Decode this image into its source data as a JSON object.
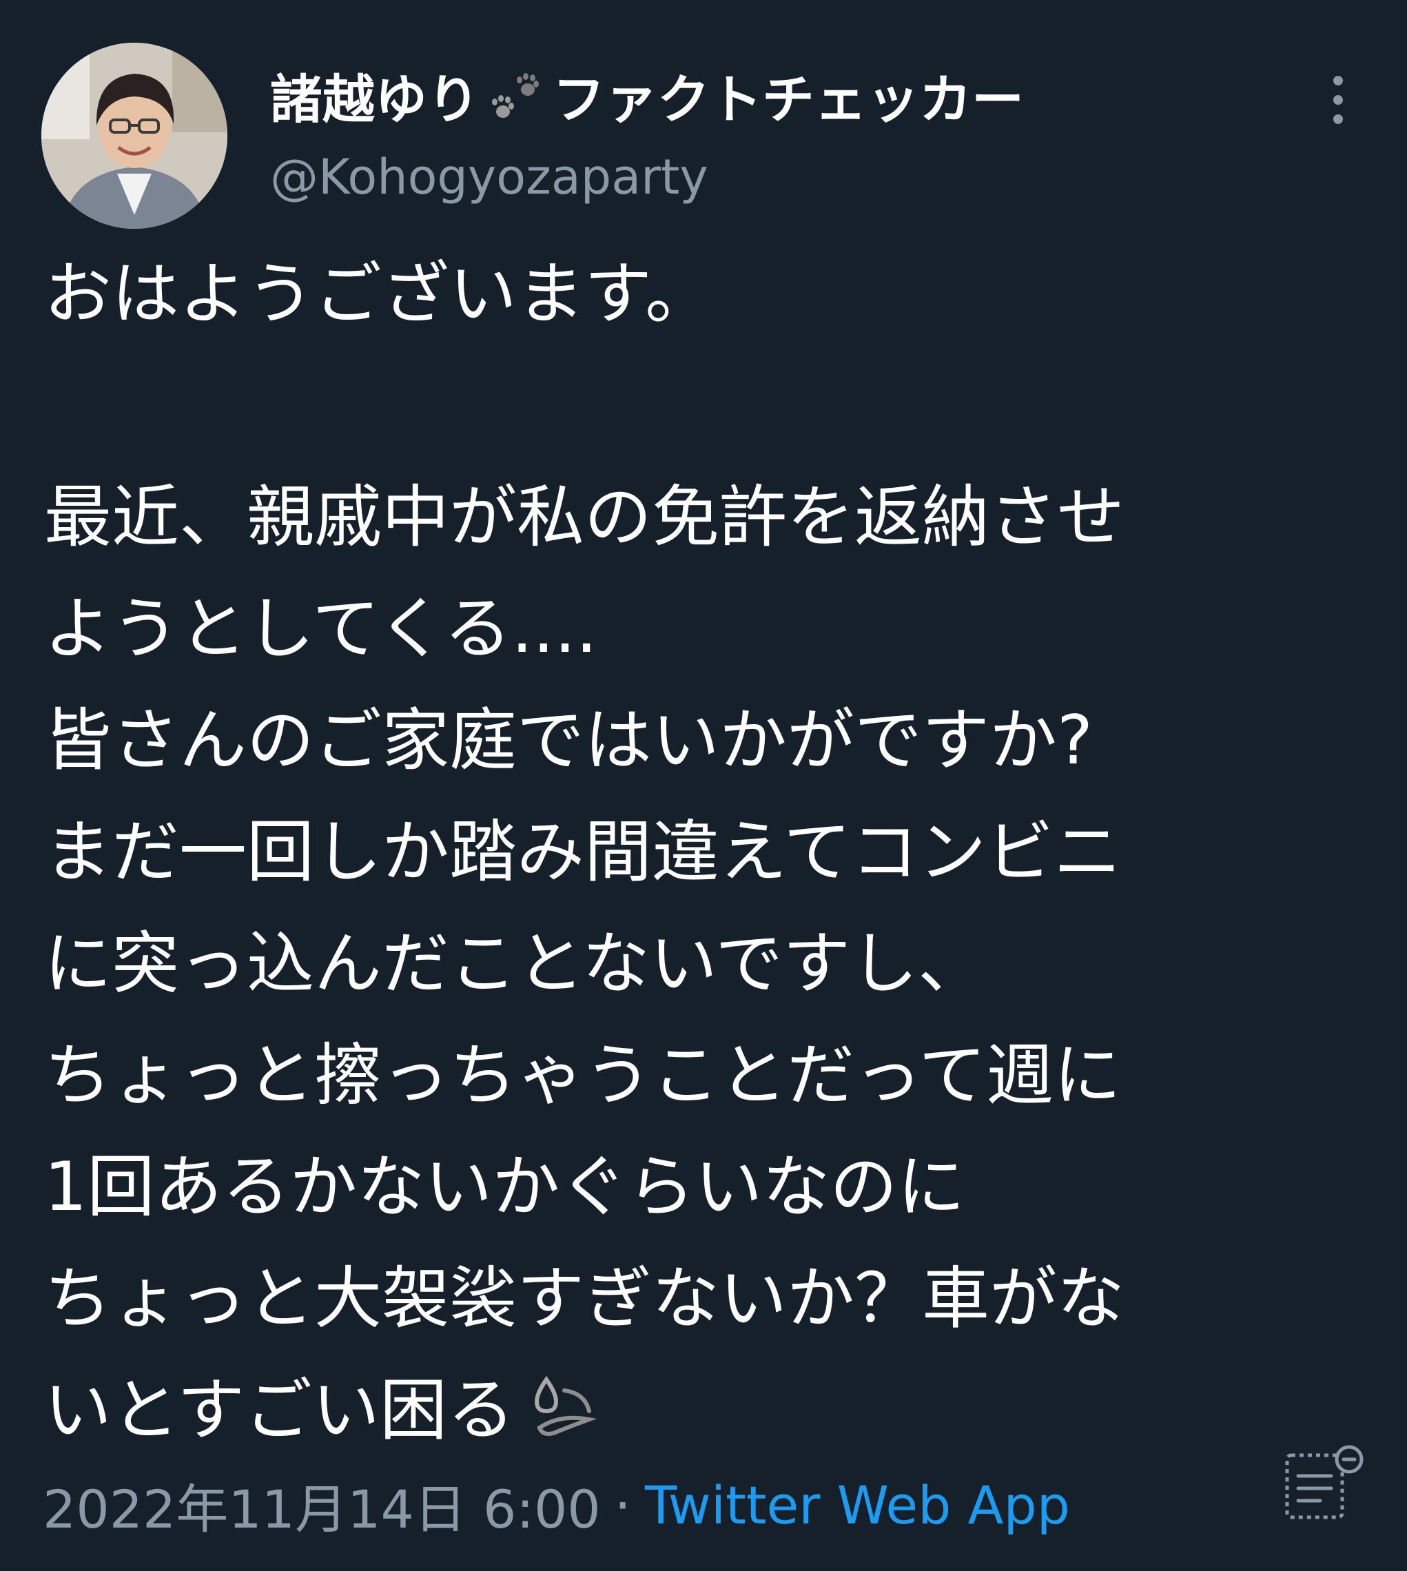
{
  "tweet": {
    "author": {
      "display_name_before_icon": "諸越ゆり",
      "display_name_icon": "paw-prints-icon",
      "display_name_after_icon": "ファクトチェッカー",
      "handle": "@Kohogyozaparty"
    },
    "body_lines": [
      "おはようございます。",
      "",
      "最近、親戚中が私の免許を返納させ",
      "ようとしてくる....",
      "皆さんのご家庭ではいかがですか?",
      "まだ一回しか踏み間違えてコンビニ",
      "に突っ込んだことないですし、",
      "ちょっと擦っちゃうことだって週に",
      "1回あるかないかぐらいなのに",
      "ちょっと大袈裟すぎないか？車がな",
      "いとすごい困る"
    ],
    "body_trailing_icon": "sweat-droplets-icon",
    "timestamp": "2022年11月14日 6:00",
    "separator": "·",
    "source": "Twitter Web App"
  },
  "icons": {
    "more": "more-vertical-icon",
    "translate": "translate-icon"
  },
  "colors": {
    "background": "#15202b",
    "primary_text": "#ffffff",
    "secondary_text": "#8b98a5",
    "accent": "#1d9bf0"
  }
}
